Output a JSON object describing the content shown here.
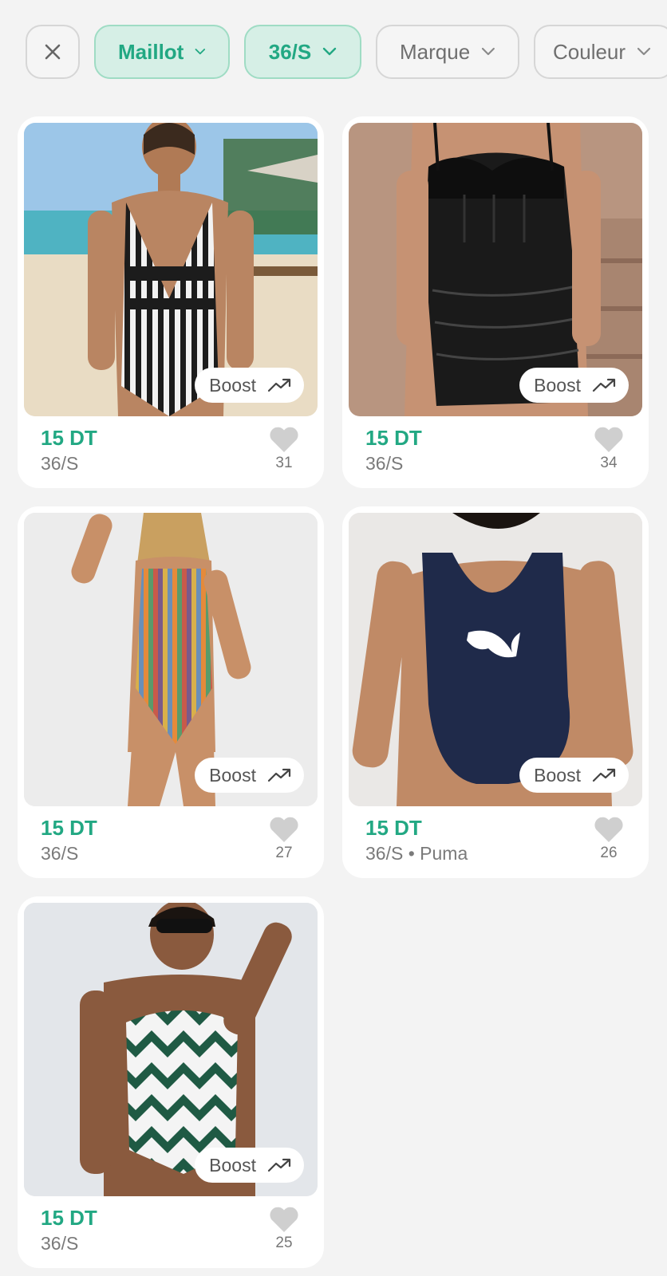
{
  "filters": {
    "clear_icon": "close-icon",
    "chips": [
      {
        "label": "Maillot",
        "active": true
      },
      {
        "label": "36/S",
        "active": true
      },
      {
        "label": "Marque",
        "active": false
      },
      {
        "label": "Couleur",
        "active": false
      }
    ]
  },
  "colors": {
    "accent": "#22a883",
    "active_chip_bg": "#d6efe6",
    "background": "#f3f3f3"
  },
  "products": [
    {
      "price": "15 DT",
      "meta": "36/S",
      "likes": "31",
      "boost_label": "Boost",
      "image": "black-white-striped-halter-swimsuit-on-beach"
    },
    {
      "price": "15 DT",
      "meta": "36/S",
      "likes": "34",
      "boost_label": "Boost",
      "image": "black-mesh-corset-swimsuit-dress"
    },
    {
      "price": "15 DT",
      "meta": "36/S",
      "likes": "27",
      "boost_label": "Boost",
      "image": "multicolor-striped-one-piece"
    },
    {
      "price": "15 DT",
      "meta": "36/S • Puma",
      "likes": "26",
      "boost_label": "Boost",
      "image": "navy-puma-one-piece"
    },
    {
      "price": "15 DT",
      "meta": "36/S",
      "likes": "25",
      "boost_label": "Boost",
      "image": "green-white-chevron-one-piece"
    }
  ]
}
